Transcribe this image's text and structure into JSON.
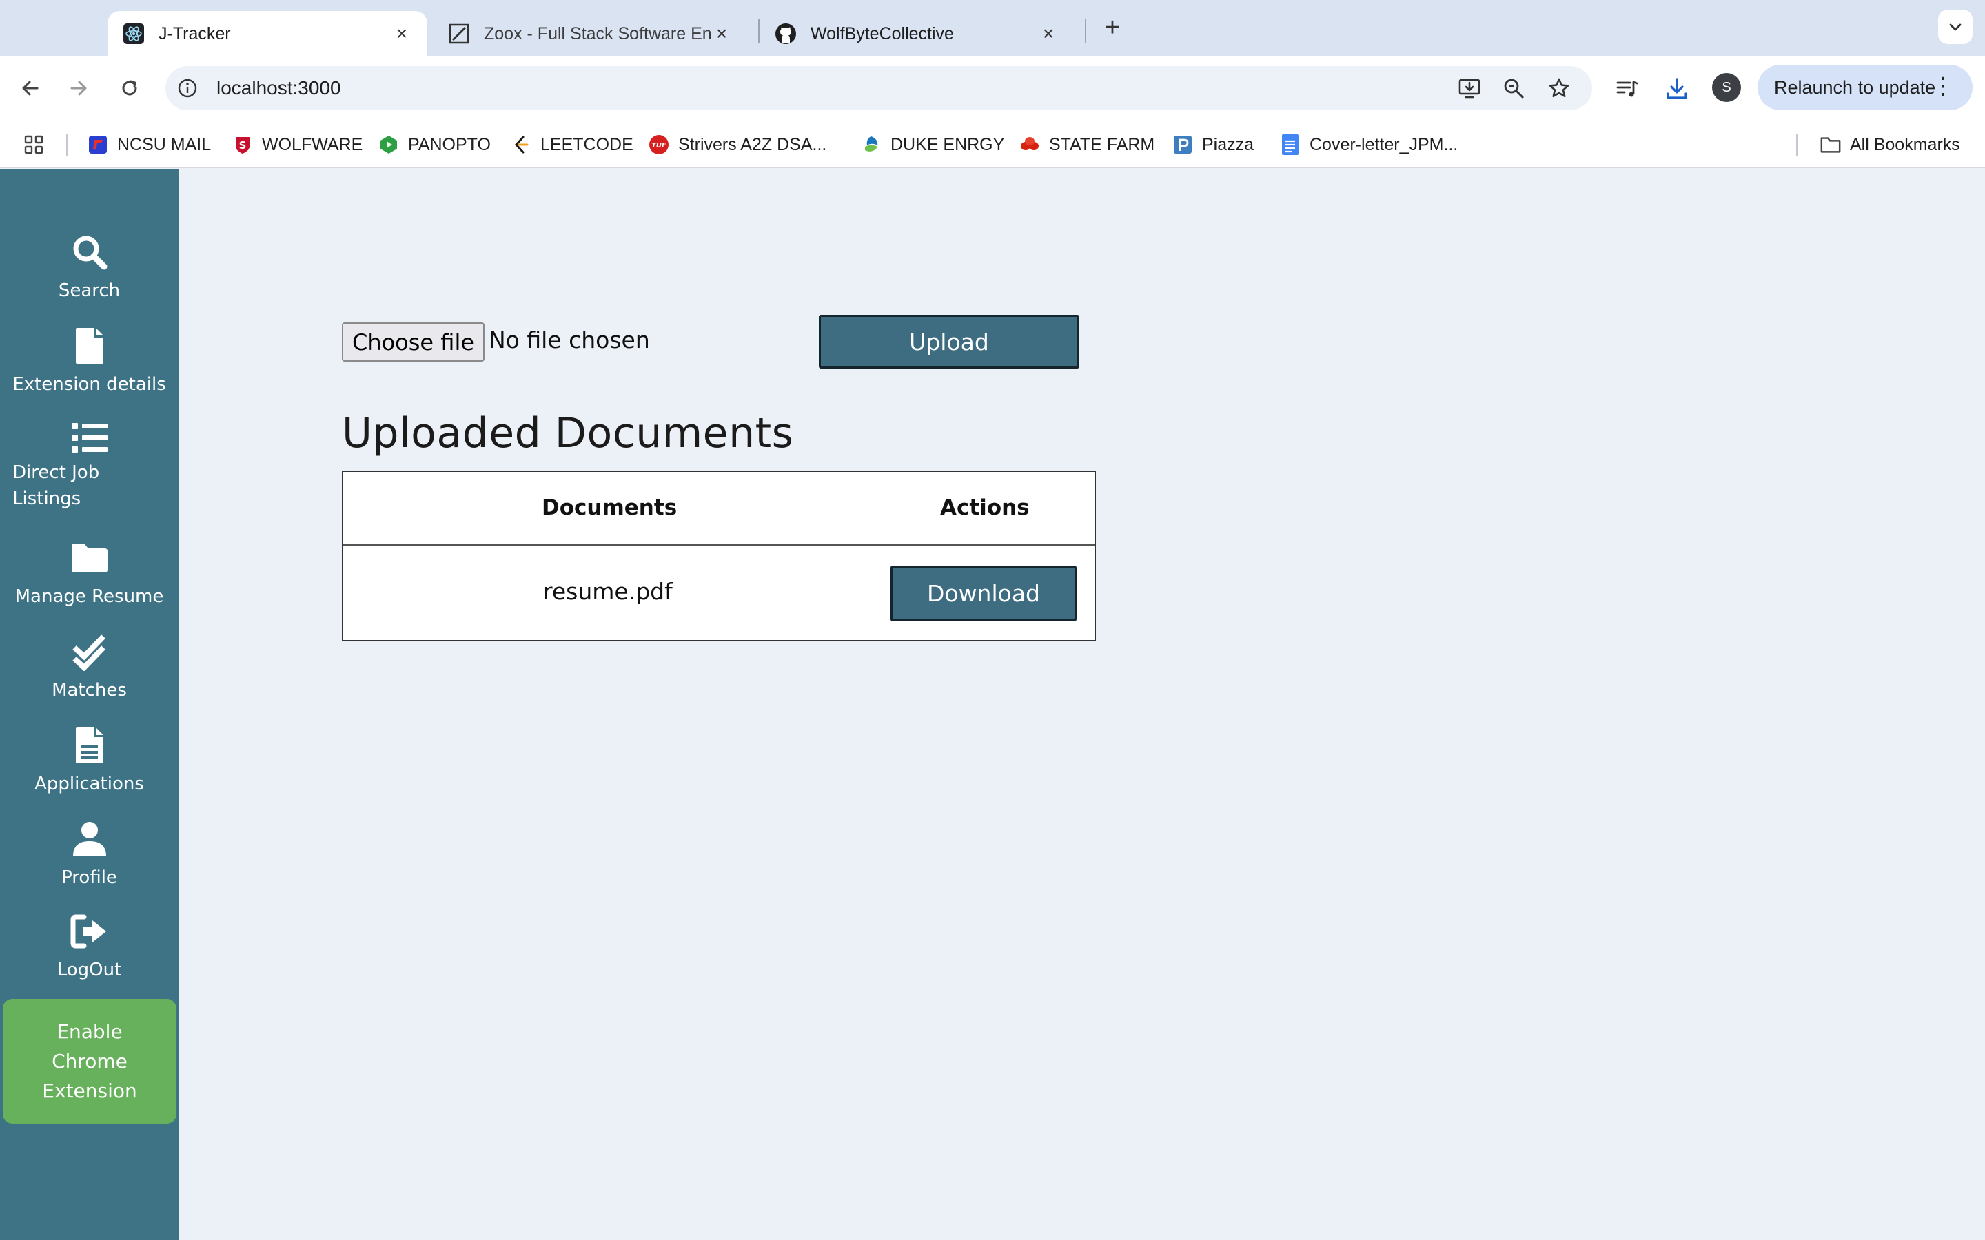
{
  "browser": {
    "tabs": [
      {
        "title": "J-Tracker",
        "icon": "react-icon",
        "active": true
      },
      {
        "title": "Zoox - Full Stack Software En",
        "icon": "zoox-icon",
        "active": false
      },
      {
        "title": "WolfByteCollective",
        "icon": "github-icon",
        "active": false
      }
    ],
    "url": "localhost:3000",
    "profile_initial": "S",
    "relaunch_label": "Relaunch to update",
    "bookmarks": [
      {
        "label": "NCSU MAIL",
        "icon": "ncsu-mail-icon"
      },
      {
        "label": "WOLFWARE",
        "icon": "wolfware-icon"
      },
      {
        "label": "PANOPTO",
        "icon": "panopto-icon"
      },
      {
        "label": "LEETCODE",
        "icon": "leetcode-icon"
      },
      {
        "label": "Strivers A2Z DSA...",
        "icon": "tuf-icon"
      },
      {
        "label": "DUKE ENRGY",
        "icon": "duke-energy-icon"
      },
      {
        "label": "STATE FARM",
        "icon": "state-farm-icon"
      },
      {
        "label": "Piazza",
        "icon": "piazza-icon"
      },
      {
        "label": "Cover-letter_JPM...",
        "icon": "google-docs-icon"
      }
    ],
    "all_bookmarks_label": "All Bookmarks"
  },
  "sidebar": {
    "items": [
      {
        "label": "Search",
        "icon": "search-icon"
      },
      {
        "label": "Extension details",
        "icon": "file-icon"
      },
      {
        "label": "Direct Job Listings",
        "icon": "list-icon"
      },
      {
        "label": "Manage Resume",
        "icon": "folder-icon"
      },
      {
        "label": "Matches",
        "icon": "double-check-icon"
      },
      {
        "label": "Applications",
        "icon": "document-icon"
      },
      {
        "label": "Profile",
        "icon": "user-icon"
      },
      {
        "label": "LogOut",
        "icon": "logout-icon"
      }
    ],
    "extension_button": "Enable Chrome Extension"
  },
  "main": {
    "choose_file_label": "Choose file",
    "file_status": "No file chosen",
    "upload_label": "Upload",
    "section_title": "Uploaded Documents",
    "table": {
      "headers": [
        "Documents",
        "Actions"
      ],
      "rows": [
        {
          "document": "resume.pdf",
          "action": "Download"
        }
      ]
    }
  },
  "colors": {
    "sidebar": "#3e7386",
    "button": "#3e6c80",
    "extension_button": "#67b15c",
    "page_background": "#ecf0f7"
  }
}
